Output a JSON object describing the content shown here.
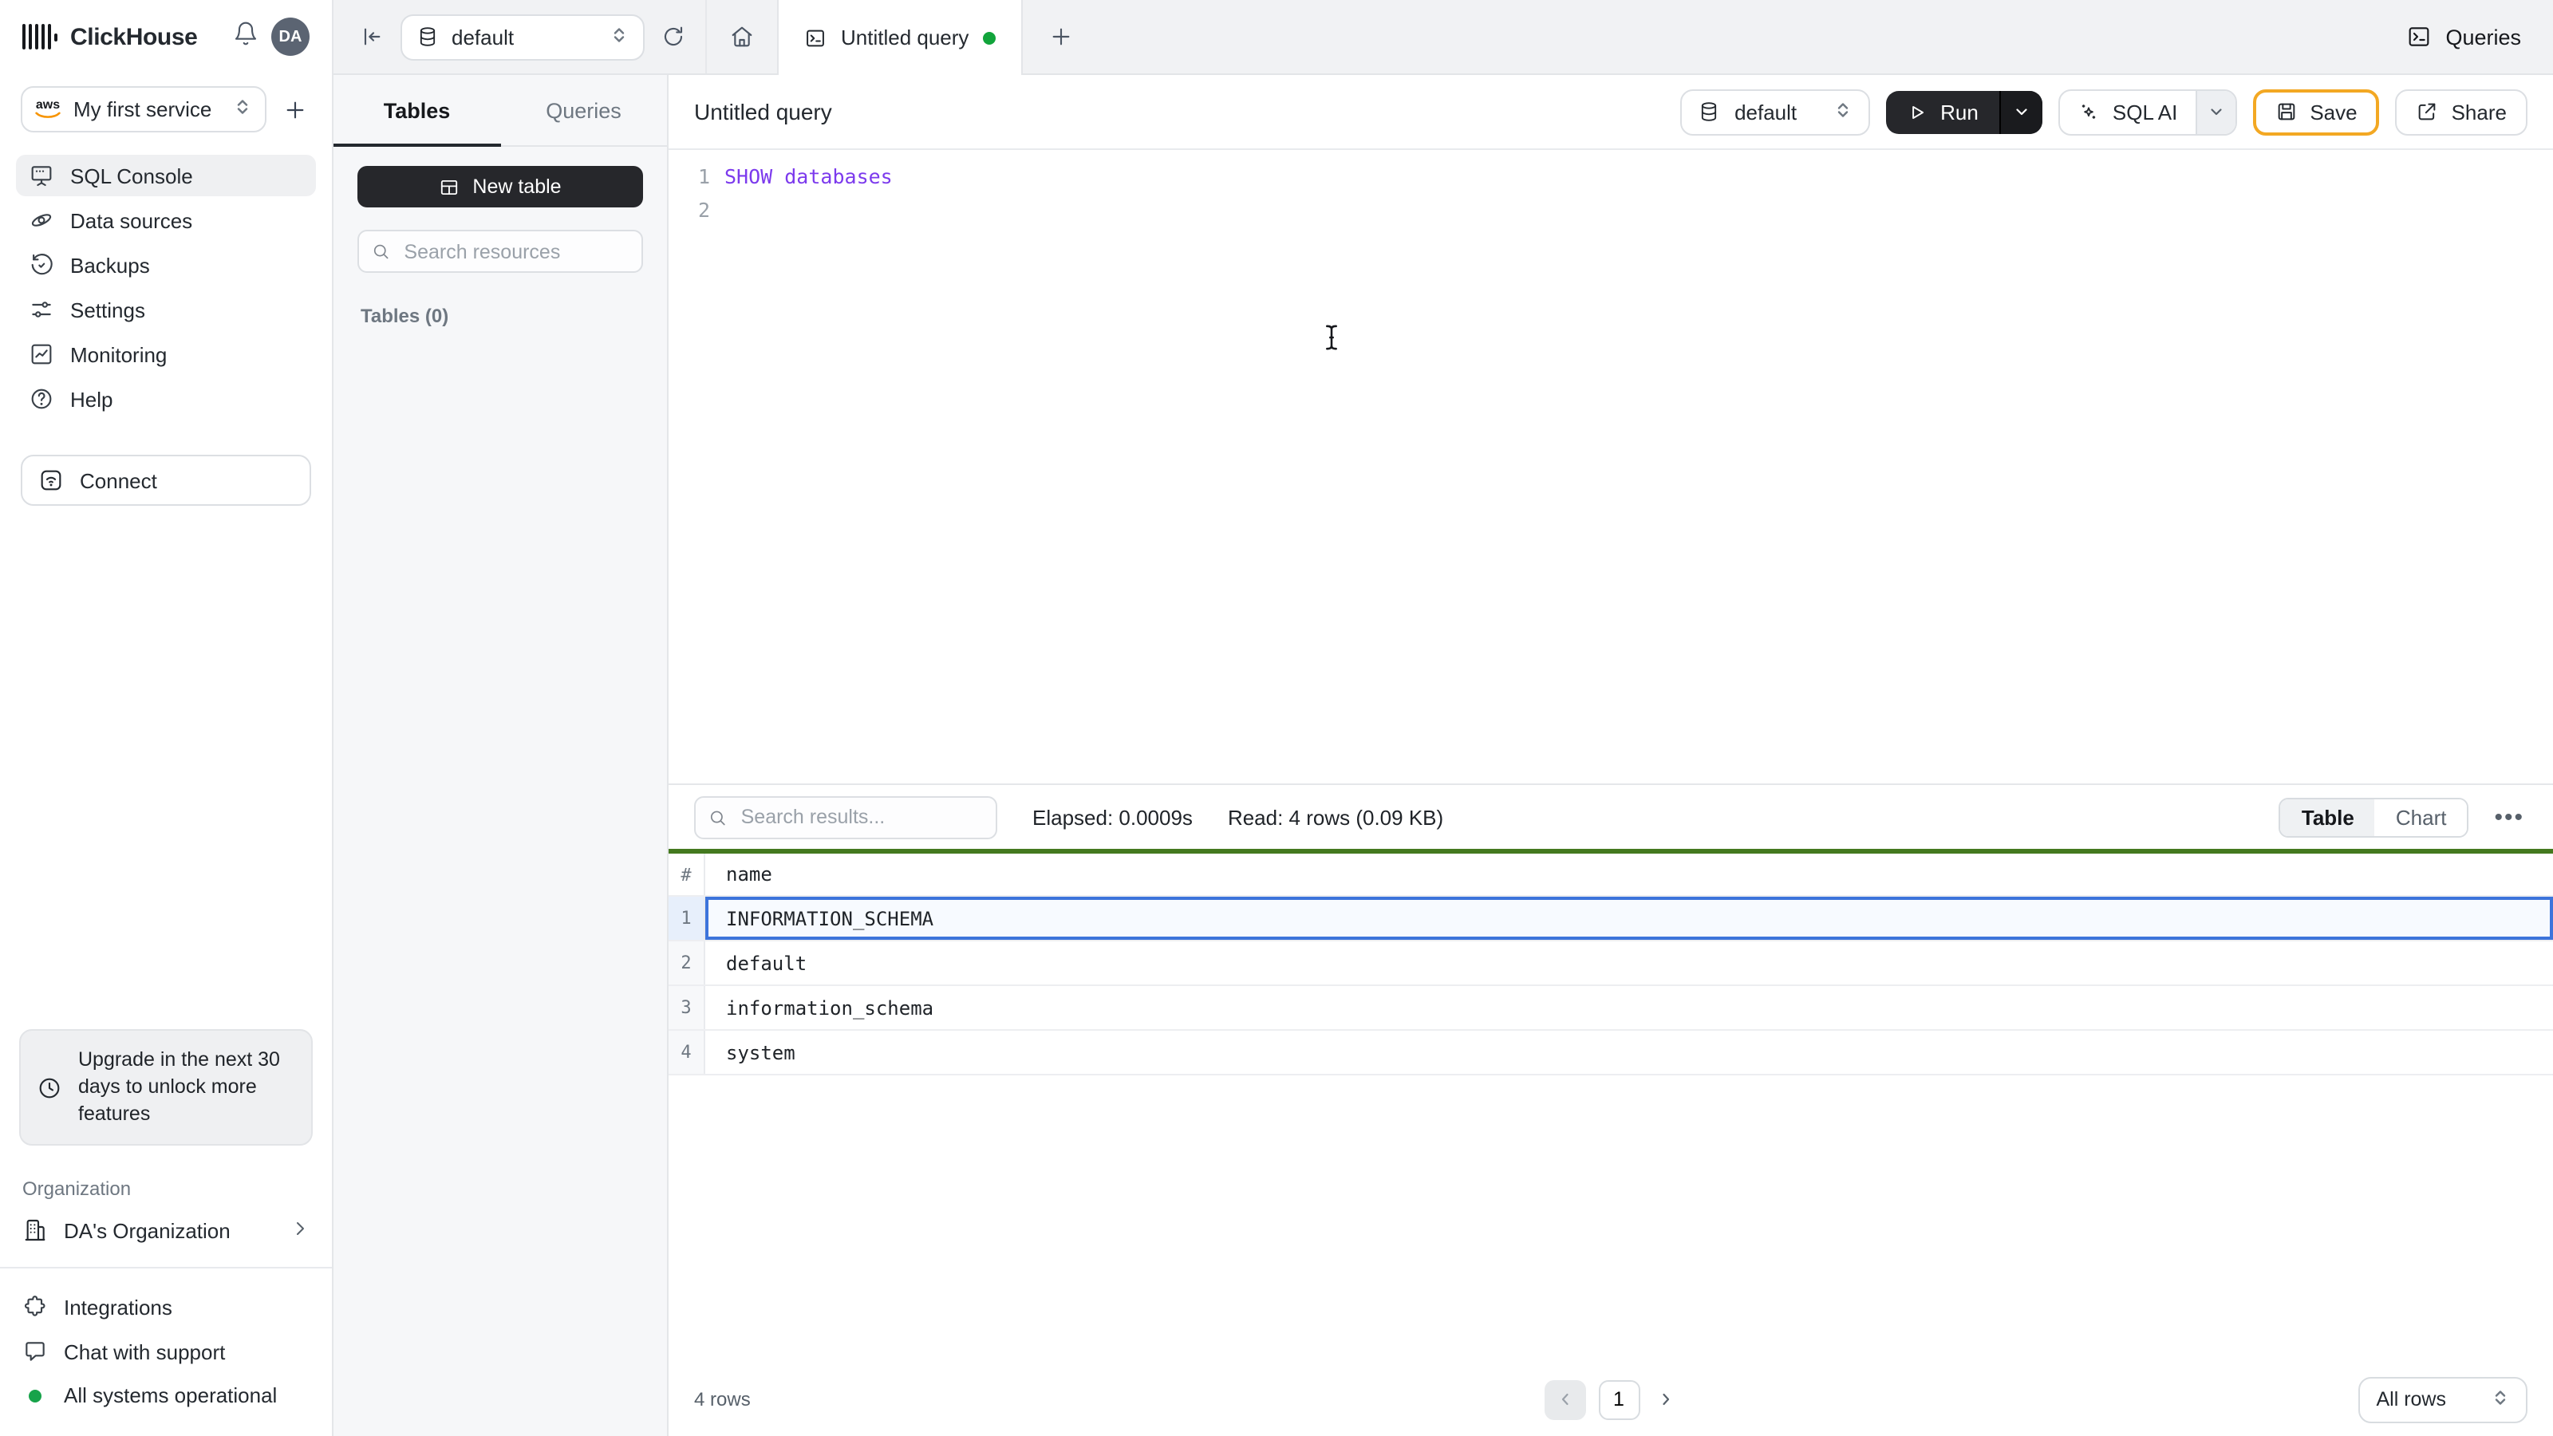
{
  "topbar": {
    "brand": "ClickHouse",
    "avatar_initials": "DA",
    "database_selector": "default",
    "tab_title": "Untitled query",
    "queries_label": "Queries"
  },
  "sidebar": {
    "service_name": "My first service",
    "nav": [
      {
        "label": "SQL Console",
        "active": true
      },
      {
        "label": "Data sources"
      },
      {
        "label": "Backups"
      },
      {
        "label": "Settings"
      },
      {
        "label": "Monitoring"
      },
      {
        "label": "Help"
      }
    ],
    "connect_label": "Connect",
    "upgrade_text": "Upgrade in the next 30 days to unlock more features",
    "organization_label": "Organization",
    "organization_name": "DA's Organization",
    "footer": [
      {
        "label": "Integrations"
      },
      {
        "label": "Chat with support"
      },
      {
        "label": "All systems operational"
      }
    ]
  },
  "explorer": {
    "tab_tables": "Tables",
    "tab_queries": "Queries",
    "new_table_label": "New table",
    "search_placeholder": "Search resources",
    "tables_count": "Tables (0)"
  },
  "query": {
    "title": "Untitled query",
    "database": "default",
    "run_label": "Run",
    "sql_ai_label": "SQL AI",
    "save_label": "Save",
    "share_label": "Share",
    "lines": [
      {
        "num": "1",
        "text": "SHOW databases"
      },
      {
        "num": "2",
        "text": ""
      }
    ]
  },
  "results": {
    "search_placeholder": "Search results...",
    "elapsed": "Elapsed: 0.0009s",
    "read": "Read: 4 rows (0.09 KB)",
    "view_table": "Table",
    "view_chart": "Chart",
    "columns": [
      "#",
      "name"
    ],
    "rows": [
      {
        "num": "1",
        "name": "INFORMATION_SCHEMA",
        "selected": true
      },
      {
        "num": "2",
        "name": "default"
      },
      {
        "num": "3",
        "name": "information_schema"
      },
      {
        "num": "4",
        "name": "system"
      }
    ],
    "rows_total": "4 rows",
    "page": "1",
    "page_size": "All rows"
  },
  "colors": {
    "sql_keyword_purple": "#7C3AED",
    "selection_blue": "#3D74DB",
    "success_bar_green": "#44791F",
    "status_green": "#17A34A",
    "save_highlight_orange": "#F3A823",
    "run_button_dark": "#26272B"
  }
}
